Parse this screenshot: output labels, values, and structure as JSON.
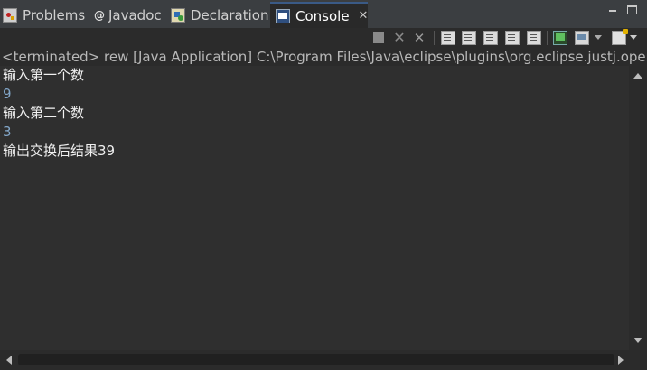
{
  "tabs": [
    {
      "label": "Problems",
      "icon": "problems-icon"
    },
    {
      "label": "Javadoc",
      "icon": "javadoc-icon",
      "glyph": "@"
    },
    {
      "label": "Declaration",
      "icon": "declaration-icon"
    },
    {
      "label": "Console",
      "icon": "console-icon",
      "active": true,
      "close_glyph": "✕"
    }
  ],
  "window_controls": {
    "minimize_icon": "minimize-icon",
    "maximize_icon": "maximize-icon"
  },
  "toolbar": {
    "icons": [
      "terminate-icon",
      "remove-launch-icon",
      "remove-all-terminated-icon",
      "word-wrap-icon",
      "scroll-lock-icon",
      "show-stdout-icon",
      "show-stderr-icon",
      "clear-console-icon",
      "pin-console-icon",
      "display-selected-console-icon",
      "open-console-icon"
    ],
    "remove_glyph": "✕",
    "remove_all_glyph": "✕"
  },
  "status_line": "<terminated> rew [Java Application] C:\\Program Files\\Java\\eclipse\\plugins\\org.eclipse.justj.openjdk",
  "console": {
    "lines": [
      {
        "text": "输入第一个数",
        "kind": "output"
      },
      {
        "text": "9",
        "kind": "input"
      },
      {
        "text": "输入第二个数",
        "kind": "output"
      },
      {
        "text": "3",
        "kind": "input"
      },
      {
        "text": "输出交换后结果39",
        "kind": "output"
      }
    ]
  },
  "colors": {
    "background": "#2f2f2f",
    "output_text": "#f0f0f0",
    "input_text": "#82a6c8",
    "active_tab_accent": "#3a5a86"
  }
}
